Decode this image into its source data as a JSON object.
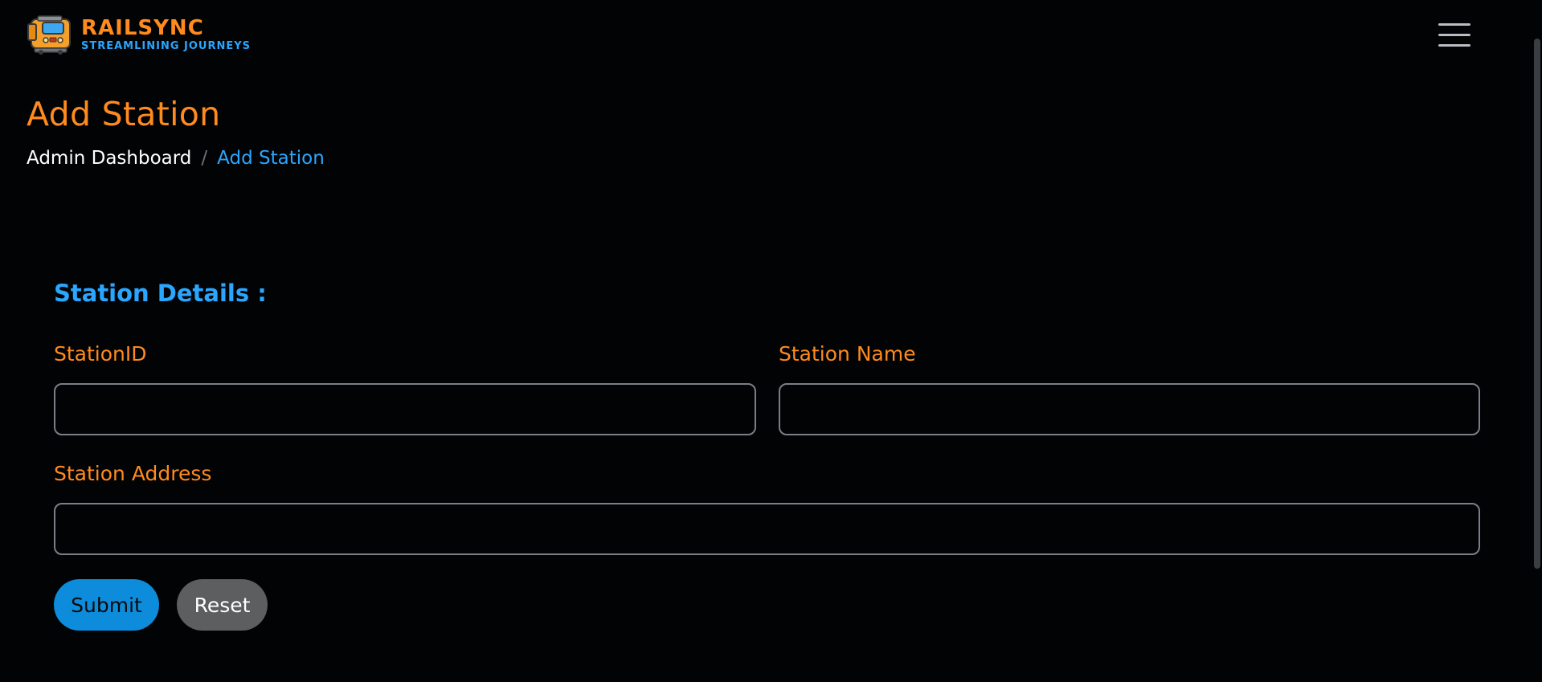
{
  "header": {
    "brand_name": "RAILSYNC",
    "brand_tagline": "STREAMLINING JOURNEYS",
    "logo_icon": "train-icon",
    "menu_icon": "hamburger-menu-icon"
  },
  "page": {
    "title": "Add Station",
    "breadcrumb": {
      "link": "Admin Dashboard",
      "separator": "/",
      "current": "Add Station"
    }
  },
  "form": {
    "section_title": "Station Details :",
    "fields": {
      "station_id": {
        "label": "StationID",
        "value": "",
        "placeholder": ""
      },
      "station_name": {
        "label": "Station Name",
        "value": "",
        "placeholder": ""
      },
      "station_address": {
        "label": "Station Address",
        "value": "",
        "placeholder": ""
      }
    },
    "submit_label": "Submit",
    "reset_label": "Reset"
  },
  "colors": {
    "background": "#020305",
    "accent_orange": "#ff8a1e",
    "accent_blue": "#2aa6ff",
    "submit_button": "#0d8cdc",
    "reset_button": "#5d5e60"
  }
}
